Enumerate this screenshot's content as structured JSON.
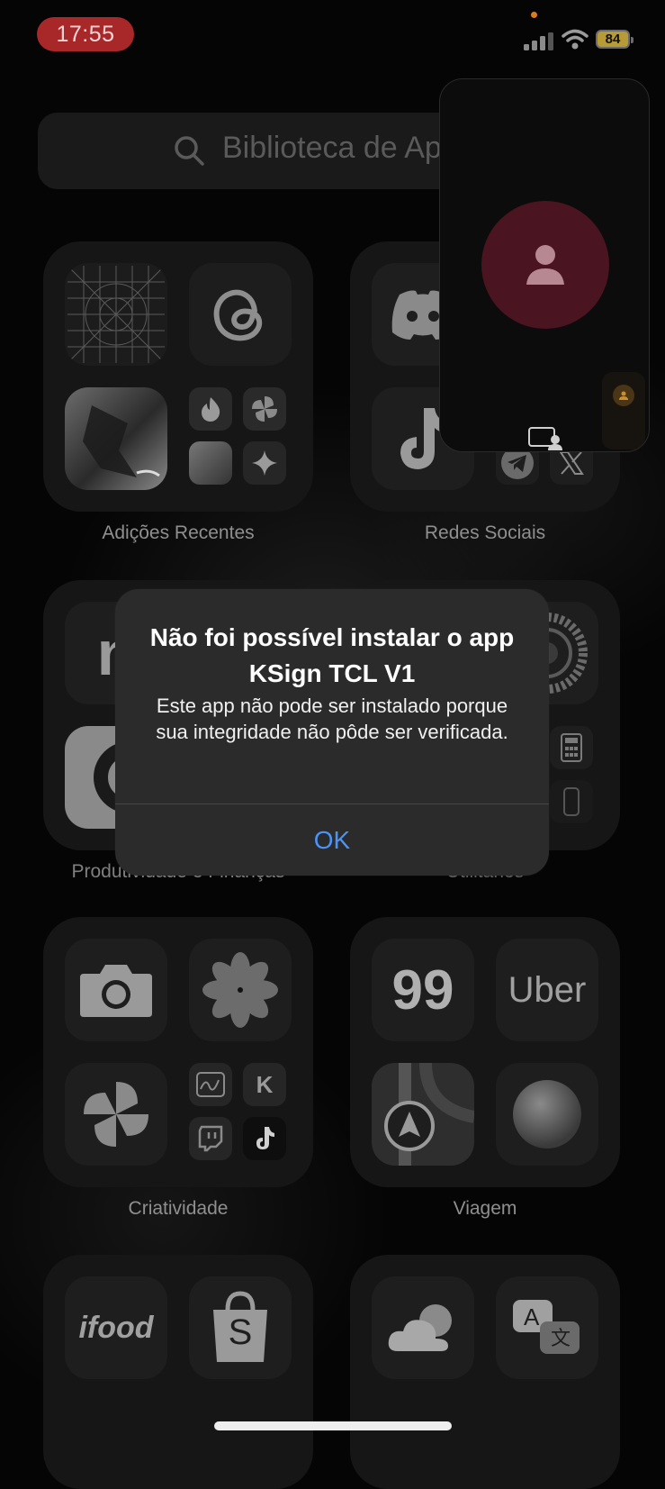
{
  "status_bar": {
    "time": "17:55",
    "battery": "84"
  },
  "search": {
    "placeholder": "Biblioteca de Ap"
  },
  "folders": [
    {
      "label": "Adições Recentes"
    },
    {
      "label": "Redes Sociais"
    },
    {
      "label": "Produtividade e Finanças"
    },
    {
      "label": "Utilitários"
    },
    {
      "label": "Criatividade"
    },
    {
      "label": "Viagem"
    }
  ],
  "app_text": {
    "ninetynine": "99",
    "uber": "Uber",
    "ifood": "ifood",
    "shopee": "S",
    "kwai": "K"
  },
  "alert": {
    "title": "Não foi possível instalar o app KSign TCL V1",
    "message": "Este app não pode ser instalado porque sua integridade não pôde ser verificada.",
    "ok": "OK"
  },
  "colors": {
    "alert_bg": "#2b2b2b",
    "ok_blue": "#4b94f4",
    "time_pill": "#a8282a",
    "pip_avatar": "#4a1420"
  },
  "icons": [
    "search-icon",
    "threads-icon",
    "discord-icon",
    "tiktok-icon",
    "telegram-icon",
    "x-icon",
    "camera-icon",
    "photos-icon",
    "settings-gear-icon",
    "calculator-icon",
    "weather-icon",
    "translate-icon"
  ]
}
